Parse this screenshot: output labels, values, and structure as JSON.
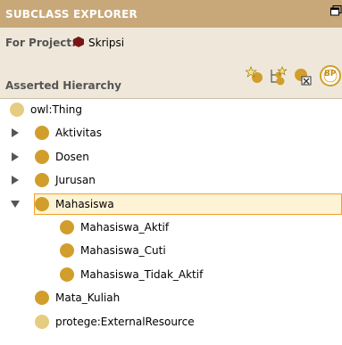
{
  "panel": {
    "title": "SUBCLASS EXPLORER",
    "project_label": "For Project:",
    "project_name": "Skripsi",
    "hierarchy_label": "Asserted Hierarchy"
  },
  "toolbar": {
    "icons": [
      "create-subclass-icon",
      "create-sibling-class-icon",
      "delete-class-icon",
      "bioportal-icon"
    ],
    "bioportal_text": "BP"
  },
  "tree": {
    "items": [
      {
        "label": "owl:Thing",
        "depth": 0,
        "arrow": "none",
        "color": "#e6cc80",
        "selected": false
      },
      {
        "label": "Aktivitas",
        "depth": 1,
        "arrow": "collapsed",
        "color": "#d19e2c",
        "selected": false
      },
      {
        "label": "Dosen",
        "depth": 1,
        "arrow": "collapsed",
        "color": "#d19e2c",
        "selected": false
      },
      {
        "label": "Jurusan",
        "depth": 1,
        "arrow": "collapsed",
        "color": "#d19e2c",
        "selected": false
      },
      {
        "label": "Mahasiswa",
        "depth": 1,
        "arrow": "expanded",
        "color": "#d19e2c",
        "selected": true
      },
      {
        "label": "Mahasiswa_Aktif",
        "depth": 2,
        "arrow": "none",
        "color": "#d19e2c",
        "selected": false
      },
      {
        "label": "Mahasiswa_Cuti",
        "depth": 2,
        "arrow": "none",
        "color": "#d19e2c",
        "selected": false
      },
      {
        "label": "Mahasiswa_Tidak_Aktif",
        "depth": 2,
        "arrow": "none",
        "color": "#d19e2c",
        "selected": false
      },
      {
        "label": "Mata_Kuliah",
        "depth": 1,
        "arrow": "none",
        "color": "#d19e2c",
        "selected": false
      },
      {
        "label": "protege:ExternalResource",
        "depth": 1,
        "arrow": "none",
        "color": "#e6cc80",
        "selected": false
      }
    ]
  },
  "colors": {
    "title_bg": "#c8a878",
    "header_bg": "#efe8da",
    "class_icon": "#d19e2c",
    "system_class_icon": "#e6cc80",
    "selection_border": "#f0a030",
    "project_icon": "#7a1515"
  }
}
